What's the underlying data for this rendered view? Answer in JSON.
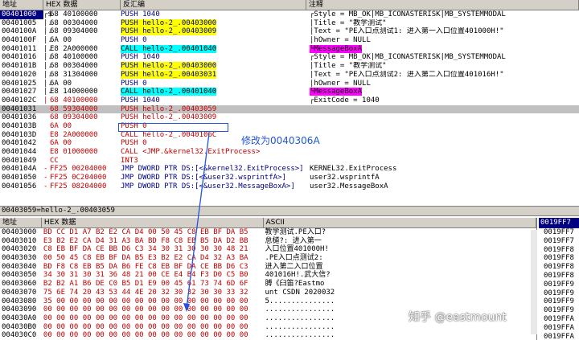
{
  "disasm": {
    "headers": [
      "地址",
      "HEX 数据",
      "反汇编",
      "注释"
    ],
    "rows": [
      {
        "addr": "00401000",
        "mark": "┌$",
        "hex": "68 40100000",
        "asm": "PUSH 1040",
        "asm_class": "asm-push",
        "cmt": "┌Style = MB_OK|MB_ICONASTERISK|MB_SYSTEMMODAL",
        "type": "sel"
      },
      {
        "addr": "00401005",
        "mark": "│.",
        "hex": "68 00304000",
        "asm": "PUSH hello-2_.00403000",
        "asm_class": "asm-push hl-y",
        "cmt": "│Title = \"教学测试\"",
        "type": ""
      },
      {
        "addr": "0040100A",
        "mark": "│.",
        "hex": "68 09304000",
        "asm": "PUSH hello-2_.00403009",
        "asm_class": "asm-push hl-y",
        "cmt": "│Text = \"PE入口点测试1: 进入第一入口位置401000H!\"",
        "type": ""
      },
      {
        "addr": "0040100F",
        "mark": "│.",
        "hex": "6A 00",
        "asm": "PUSH 0",
        "asm_class": "asm-push",
        "cmt": "│hOwner = NULL",
        "type": ""
      },
      {
        "addr": "00401011",
        "mark": "│.",
        "hex": "E8 2A000000",
        "asm": "CALL hello-2_.00401040",
        "asm_class": "asm-call hl-c",
        "cmt": "└MessageBoxA",
        "type": "mb"
      },
      {
        "addr": "00401016",
        "mark": "│.",
        "hex": "68 40100000",
        "asm": "PUSH 1040",
        "asm_class": "asm-push",
        "cmt": "┌Style = MB_OK|MB_ICONASTERISK|MB_SYSTEMMODAL",
        "type": ""
      },
      {
        "addr": "0040101B",
        "mark": "│.",
        "hex": "68 00304000",
        "asm": "PUSH hello-2_.00403000",
        "asm_class": "asm-push hl-y",
        "cmt": "│Title = \"教学测试\"",
        "type": ""
      },
      {
        "addr": "00401020",
        "mark": "│.",
        "hex": "68 31304000",
        "asm": "PUSH hello-2_.00403031",
        "asm_class": "asm-push hl-y",
        "cmt": "│Text = \"PE入口点测试2: 进入第二入口位置401016H!\"",
        "type": ""
      },
      {
        "addr": "00401025",
        "mark": "│.",
        "hex": "6A 00",
        "asm": "PUSH 0",
        "asm_class": "asm-push",
        "cmt": "│hOwner = NULL",
        "type": ""
      },
      {
        "addr": "00401027",
        "mark": "│.",
        "hex": "E8 14000000",
        "asm": "CALL hello-2_.00401040",
        "asm_class": "asm-call hl-c",
        "cmt": "└MessageBoxA",
        "type": "mb"
      },
      {
        "addr": "0040102C",
        "mark": "│",
        "hex": "68 40100000",
        "asm": "PUSH 1040",
        "asm_class": "asm-push",
        "cmt": "┌ExitCode = 1040",
        "type": "red"
      },
      {
        "addr": "00401031",
        "mark": "",
        "hex": "68 59304000",
        "asm": "PUSH hello-2_.00403059",
        "asm_class": "",
        "cmt": "",
        "type": "red gray"
      },
      {
        "addr": "00401036",
        "mark": "",
        "hex": "68 09304000",
        "asm": "PUSH hello-2_.00403009",
        "asm_class": "",
        "cmt": "",
        "type": "red"
      },
      {
        "addr": "0040103B",
        "mark": "",
        "hex": "6A 00",
        "asm": "PUSH 0",
        "asm_class": "",
        "cmt": "",
        "type": "red"
      },
      {
        "addr": "0040103D",
        "mark": "",
        "hex": "E8 2A000000",
        "asm": "CALL hello-2_.0040106C",
        "asm_class": "",
        "cmt": "",
        "type": "red"
      },
      {
        "addr": "00401042",
        "mark": "",
        "hex": "6A 00",
        "asm": "PUSH 0",
        "asm_class": "",
        "cmt": "",
        "type": "red"
      },
      {
        "addr": "00401044",
        "mark": "",
        "hex": "E8 01000000",
        "asm": "CALL <JMP.&kernel32.ExitProcess>",
        "asm_class": "",
        "cmt": "",
        "type": "red"
      },
      {
        "addr": "00401049",
        "mark": "",
        "hex": "CC",
        "asm": "INT3",
        "asm_class": "asm-int",
        "cmt": "",
        "type": "red"
      },
      {
        "addr": "0040104A",
        "mark": "-",
        "hex": "FF25 00204000",
        "asm": "JMP DWORD PTR DS:[<&kernel32.ExitProcess>]",
        "asm_class": "asm-jmp",
        "cmt": "KERNEL32.ExitProcess",
        "type": "redmark"
      },
      {
        "addr": "00401050",
        "mark": "-",
        "hex": "FF25 0C204000",
        "asm": "JMP DWORD PTR DS:[<&user32.wsprintfA>]",
        "asm_class": "asm-jmp",
        "cmt": "user32.wsprintfA",
        "type": "redmark"
      },
      {
        "addr": "00401056",
        "mark": "-",
        "hex": "FF25 08204000",
        "asm": "JMP DWORD PTR DS:[<&user32.MessageBoxA>]",
        "asm_class": "asm-jmp",
        "cmt": "user32.MessageBoxA",
        "type": "redmark"
      }
    ]
  },
  "status_line": "00403059=hello-2_.00403059",
  "dump": {
    "headers": [
      "地址",
      "HEX 数据",
      "ASCII"
    ],
    "rows": [
      {
        "addr": "00403000",
        "hex": "BD CC D1 A7 B2 E2 CA D4 00 50 45 C8 EB BF DA B5",
        "ascii": "教学测试.PE入口?"
      },
      {
        "addr": "00403010",
        "hex": "E3 B2 E2 CA D4 31 A3 BA BD F8 C8 EB B5 DA D2 BB",
        "ascii": "怠檤?: 进入第一"
      },
      {
        "addr": "00403020",
        "hex": "C8 EB BF DA CE BB D6 C3 34 30 31 30 30 30 48 21",
        "ascii": "入口位置401000H!"
      },
      {
        "addr": "00403030",
        "hex": "00 50 45 C8 EB BF DA B5 E3 B2 E2 CA D4 32 A3 BA",
        "ascii": ".PE入口点测试2:"
      },
      {
        "addr": "00403040",
        "hex": "BD F8 C8 EB B5 DA B6 FE C8 EB BF DA CE BB D6 C3",
        "ascii": "进入第二入口位置"
      },
      {
        "addr": "00403050",
        "hex": "34 30 31 30 31 36 48 21 00 CE E4 B4 F3 D0 C5 B0",
        "ascii": "401016H!.武大信?"
      },
      {
        "addr": "00403060",
        "hex": "B2 B2 A1 B6 DE C0 B5 D1 E9 00 45 61 73 74 6D 6F",
        "ascii": "膊《臼笛?Eastmo"
      },
      {
        "addr": "00403070",
        "hex": "75 6E 74 20 43 53 44 4E 20 32 30 32 30 30 33 32",
        "ascii": "unt CSDN 2020032"
      },
      {
        "addr": "00403080",
        "hex": "35 00 00 00 00 00 00 00 00 00 00 00 00 00 00 00",
        "ascii": "5..............."
      },
      {
        "addr": "00403090",
        "hex": "00 00 00 00 00 00 00 00 00 00 00 00 00 00 00 00",
        "ascii": "................"
      },
      {
        "addr": "004030A0",
        "hex": "00 00 00 00 00 00 00 00 00 00 00 00 00 00 00 00",
        "ascii": "................"
      },
      {
        "addr": "004030B0",
        "hex": "00 00 00 00 00 00 00 00 00 00 00 00 00 00 00 00",
        "ascii": "................"
      },
      {
        "addr": "004030C0",
        "hex": "00 00 00 00 00 00 00 00 00 00 00 00 00 00 00 00",
        "ascii": "................"
      }
    ]
  },
  "stack": {
    "header": "0019FF7",
    "rows": [
      "0019FF7",
      "0019FF7",
      "0019FF8",
      "0019FF8",
      "0019FF8",
      "0019FF8",
      "0019FF9",
      "0019FF9",
      "0019FF9",
      "0019FF9",
      "0019FFA",
      "0019FFA",
      "0019FFA"
    ]
  },
  "annotation": "修改为0040306A",
  "watermark": "知乎 @eastmount"
}
